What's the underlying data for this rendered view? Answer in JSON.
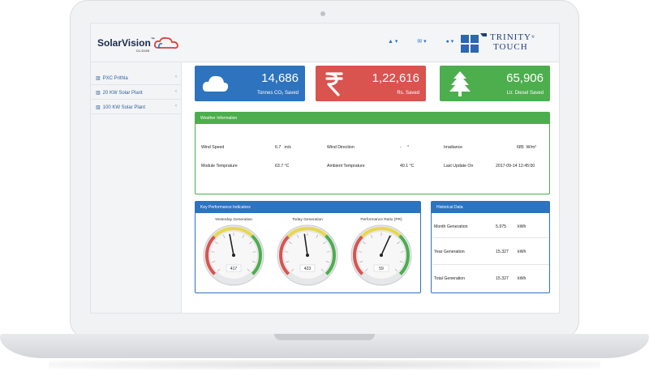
{
  "brand": {
    "name": "SolarVision",
    "tm": "™",
    "tagline": "CLOUD",
    "partner_line1": "TRINITY",
    "partner_line2": "TOUCH",
    "partner_mark": "®"
  },
  "topnav": {
    "notifications": "▲ ▾",
    "messages": "✉ ▾",
    "user": "● ▾"
  },
  "sidebar": {
    "items": [
      {
        "label": "PXC Prithla",
        "icon": "bar-chart-icon"
      },
      {
        "label": "20 KW Solar Plant",
        "icon": "bar-chart-icon"
      },
      {
        "label": "100 KW Solar Plant",
        "icon": "bar-chart-icon"
      }
    ]
  },
  "cards": [
    {
      "value": "14,686",
      "label": "Tonnes CO₂ Saved",
      "icon": "cloud-icon",
      "color": "#2d73bd"
    },
    {
      "value": "1,22,616",
      "label": "Rs. Saved",
      "icon": "rupee-icon",
      "color": "#d9534f"
    },
    {
      "value": "65,906",
      "label": "Ltr. Diesel Saved",
      "icon": "tree-icon",
      "color": "#4cae4c"
    }
  ],
  "weather": {
    "title": "Weather Information",
    "wind_speed_label": "Wind Speed",
    "wind_speed_value": "6.7",
    "wind_speed_unit": "m/s",
    "wind_direction_label": "Wind Direction",
    "wind_direction_value": "-",
    "wind_direction_unit": "°",
    "irradiance_label": "Irradiance",
    "irradiance_value": "685",
    "irradiance_unit": "W/m²",
    "module_temp_label": "Module Temprature",
    "module_temp_value": "63.7 °C",
    "ambient_temp_label": "Ambient Temprature",
    "ambient_temp_value": "40.1 °C",
    "last_update_label": "Last Update On",
    "last_update_value": "2017-09-14 12:45:00"
  },
  "kpi": {
    "title": "Key Performance Indicators",
    "gauges": [
      {
        "title": "Yesterday Generation",
        "value": "417",
        "needle_fraction": 0.46
      },
      {
        "title": "Today Generation",
        "value": "423",
        "needle_fraction": 0.47
      },
      {
        "title": "Performance Ratio (PR)",
        "value": "59",
        "needle_fraction": 0.59
      }
    ]
  },
  "historical": {
    "title": "Historical Data",
    "rows": [
      {
        "label": "Month Generation",
        "value": "5.975",
        "unit": "kWh"
      },
      {
        "label": "Year Generation",
        "value": "15.327",
        "unit": "kWh"
      },
      {
        "label": "Total Generation",
        "value": "15.327",
        "unit": "kWh"
      }
    ]
  },
  "colors": {
    "blue": "#2d73bd",
    "red": "#d9534f",
    "green": "#4cae4c"
  }
}
